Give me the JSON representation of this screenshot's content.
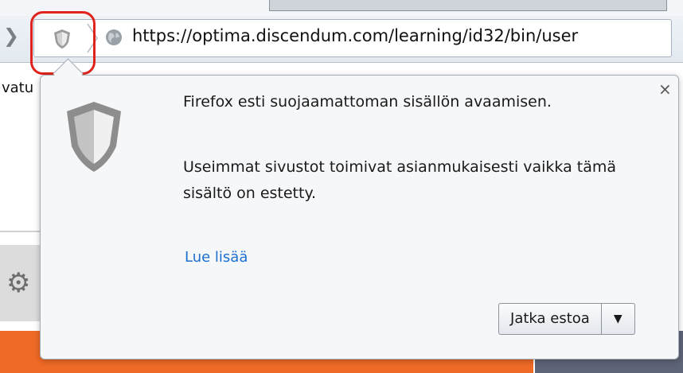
{
  "toolbar": {
    "url": "https://optima.discendum.com/learning/id32/bin/user",
    "shield_icon": "shield-icon",
    "globe_icon": "globe-icon"
  },
  "background": {
    "sidebar_text": "vatu",
    "settings_icon": "gears-icon",
    "accent_color": "#ef6a25"
  },
  "popup": {
    "title": "Firefox esti suojaamattoman sisällön avaamisen.",
    "body": "Useimmat sivustot toimivat asianmukaisesti vaikka tämä sisältö on estetty.",
    "learn_more": "Lue lisää",
    "close": "×",
    "button_label": "Jatka estoa",
    "dropdown_arrow": "▼",
    "link_color": "#1a6fd1"
  },
  "highlight_color": "#e0231c"
}
